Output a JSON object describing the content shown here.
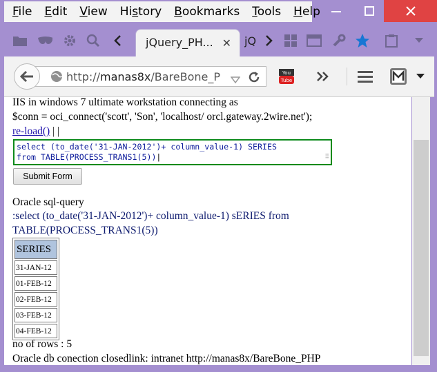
{
  "menu": [
    "File",
    "Edit",
    "View",
    "History",
    "Bookmarks",
    "Tools",
    "Help"
  ],
  "menu_underline": [
    "F",
    "E",
    "V",
    "s",
    "B",
    "T",
    "H"
  ],
  "tabs": {
    "active_title": "jQuery_PH...",
    "inactive_title": "jQ"
  },
  "navbar": {
    "url_prefix": "http://",
    "url_host": "manas8x",
    "url_path": "/BareBone_P"
  },
  "page": {
    "line1": "IIS in windows 7 ultimate workstation connecting as",
    "line2": "$conn = oci_connect('scott', 'Son', 'localhost/ orcl.gateway.2wire.net');",
    "reload_link": "re-load()",
    "reload_suffix": " | |",
    "sql_line1": "select (to_date('31-JAN-2012')+ column_value-1) SERIES",
    "sql_line2": "from TABLE(PROCESS_TRANS1(5))",
    "submit_label": "Submit Form",
    "oracle_heading": "Oracle sql-query",
    "query_line1": ":select (to_date('31-JAN-2012')+ column_value-1) sERIES from",
    "query_line2": "TABLE(PROCESS_TRANS1(5))",
    "table_header": "SERIES",
    "table_rows": [
      "31-JAN-12",
      "01-FEB-12",
      "02-FEB-12",
      "03-FEB-12",
      "04-FEB-12"
    ],
    "rows_count": "no of rows : 5",
    "closing_line": "Oracle db conection closedlink: intranet http://manas8x/BareBone_PHP"
  },
  "colors": {
    "titlebar": "#a48fd0",
    "close": "#e04343",
    "link": "#1a0dab",
    "sql_border": "#0b8a1a"
  }
}
